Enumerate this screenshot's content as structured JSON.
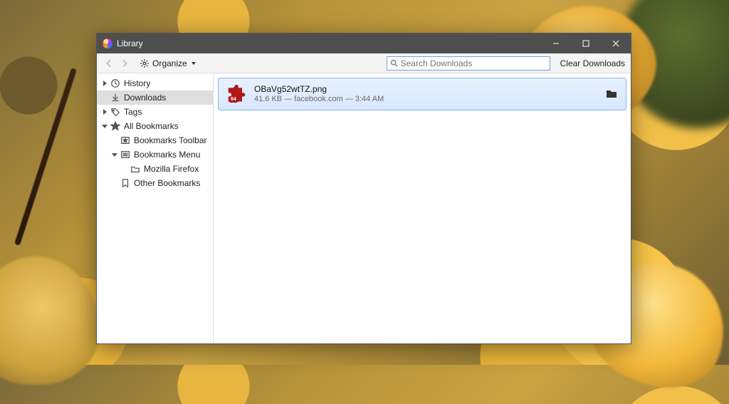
{
  "window": {
    "title": "Library"
  },
  "toolbar": {
    "organize_label": "Organize",
    "search_placeholder": "Search Downloads",
    "clear_label": "Clear Downloads"
  },
  "sidebar": {
    "history": "History",
    "downloads": "Downloads",
    "tags": "Tags",
    "all_bookmarks": "All Bookmarks",
    "toolbar": "Bookmarks Toolbar",
    "menu": "Bookmarks Menu",
    "mozilla": "Mozilla Firefox",
    "other": "Other Bookmarks"
  },
  "download": {
    "filename": "OBaVg52wtTZ.png",
    "size": "41.6 KB",
    "source": "facebook.com",
    "time": "3:44 AM",
    "badge": "64"
  }
}
